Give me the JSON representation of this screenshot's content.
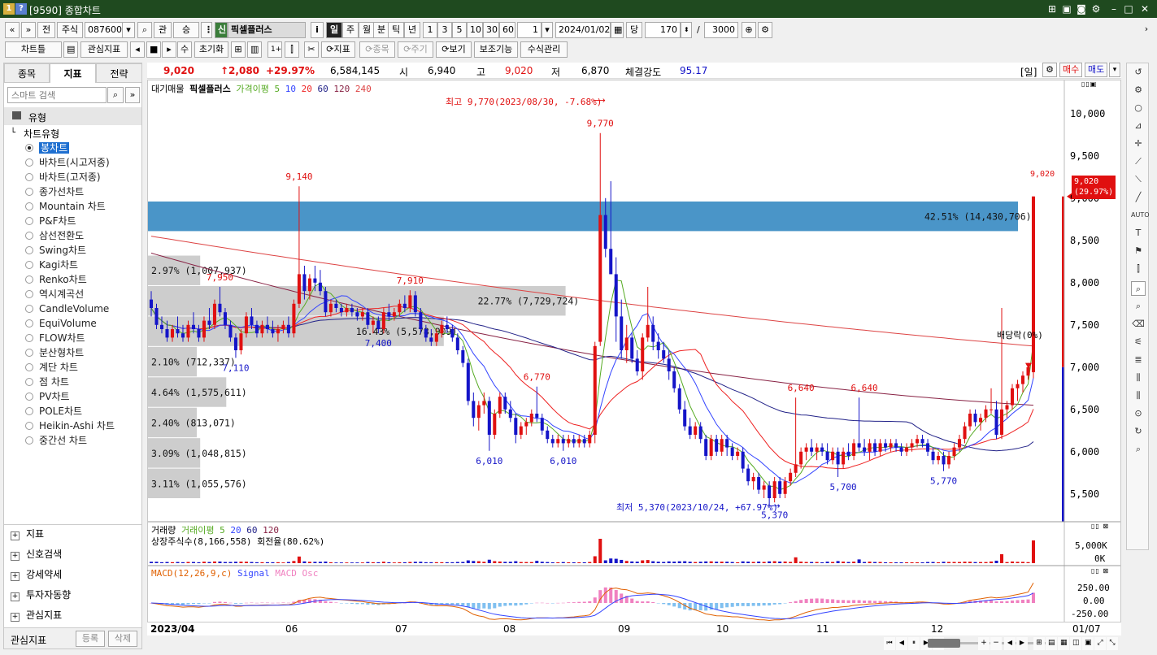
{
  "window": {
    "icon1": "1",
    "icon2": "?",
    "title": "[9590] 종합차트"
  },
  "toolbar1": {
    "nav_prev": "«",
    "nav_up": "»",
    "prev": "전",
    "market": "주식",
    "code": "087600",
    "gwan": "관",
    "seung": "승",
    "sin_badge": "신",
    "stock_name": "픽셀플러스",
    "info": "i",
    "periods": [
      "일",
      "주",
      "월",
      "분",
      "틱",
      "년"
    ],
    "intervals": [
      "1",
      "3",
      "5",
      "10",
      "30",
      "60"
    ],
    "interval_value": "1",
    "date": "2024/01/02",
    "dang": "당",
    "count": "170",
    "slash": "/",
    "max": "3000"
  },
  "toolbar2": {
    "chart_frame": "차트틀",
    "watch_indicator": "관심지표",
    "su": "수",
    "reset": "초기화",
    "scissors": "✂",
    "indicator": "지표",
    "item": "종목",
    "cycle": "주기",
    "view": "보기",
    "aux": "보조기능",
    "formula": "수식관리"
  },
  "left": {
    "tabs": [
      "종목",
      "지표",
      "전략"
    ],
    "search_placeholder": "스마트 검색",
    "group": "유형",
    "subgroup": "차트유형",
    "types": [
      "봉차트",
      "바차트(시고저종)",
      "바차트(고저종)",
      "종가선차트",
      "Mountain 차트",
      "P&F차트",
      "삼선전환도",
      "Swing차트",
      "Kagi차트",
      "Renko차트",
      "역시계곡선",
      "CandleVolume",
      "EquiVolume",
      "FLOW차트",
      "분산형차트",
      "계단 차트",
      "점 차트",
      "PV차트",
      "POLE차트",
      "Heikin-Ashi 차트",
      "중간선 차트"
    ],
    "sections": [
      "지표",
      "신호검색",
      "강세약세",
      "투자자동향",
      "관심지표"
    ],
    "footer_label": "관심지표",
    "register": "등록",
    "delete": "삭제"
  },
  "info": {
    "price": "9,020",
    "change": "↑2,080",
    "rate": "+29.97%",
    "volume": "6,584,145",
    "open_label": "시",
    "open": "6,940",
    "high_label": "고",
    "high": "9,020",
    "low_label": "저",
    "low": "6,870",
    "strength_label": "체결강도",
    "strength": "95.17",
    "period_tag": "[일]",
    "buy": "매수",
    "sell": "매도"
  },
  "legend": {
    "a": "대기매물",
    "b": "픽셀플러스",
    "c": "가격이평 5",
    "d": "10",
    "e": "20",
    "f": "60",
    "g": "120",
    "h": "240"
  },
  "annotations": {
    "high_note": "최고 9,770(2023/08/30, -7.68%)",
    "low_note": "최저 5,370(2023/10/24, +67.97%)",
    "dividend": "배당락(0%)",
    "last_price": "9,020",
    "last_tag1": "9,020",
    "last_tag2": "(29.97%)"
  },
  "colors": {
    "up": "#e01010",
    "down": "#1414c8",
    "ma5": "#55aa22",
    "ma10": "#3344ff",
    "ma20": "#ee2222",
    "ma60": "#222288",
    "ma120": "#882244",
    "ma240": "#dd4444",
    "profile_blue": "#4a95c8",
    "profile_gray": "#c8c8c8"
  },
  "chart_data": {
    "type": "candlestick",
    "period": "daily",
    "ylim": [
      5200,
      10200
    ],
    "y_ticks": [
      "10,000",
      "9,500",
      "9,000",
      "8,500",
      "8,000",
      "7,500",
      "7,000",
      "6,500",
      "6,000",
      "5,500"
    ],
    "x_ticks": [
      "2023/04",
      "06",
      "07",
      "08",
      "09",
      "10",
      "11",
      "12",
      "01/07"
    ],
    "price_labels": [
      {
        "text": "9,140",
        "i": 28,
        "v": 9140,
        "pos": "above"
      },
      {
        "text": "7,950",
        "i": 13,
        "v": 7950,
        "pos": "above"
      },
      {
        "text": "7,110",
        "i": 16,
        "v": 7110,
        "pos": "below"
      },
      {
        "text": "7,910",
        "i": 49,
        "v": 7910,
        "pos": "above"
      },
      {
        "text": "7,400",
        "i": 43,
        "v": 7400,
        "pos": "below"
      },
      {
        "text": "9,770",
        "i": 85,
        "v": 9770,
        "pos": "above"
      },
      {
        "text": "6,770",
        "i": 73,
        "v": 6770,
        "pos": "above"
      },
      {
        "text": "6,010",
        "i": 64,
        "v": 6010,
        "pos": "below"
      },
      {
        "text": "6,010",
        "i": 78,
        "v": 6010,
        "pos": "below"
      },
      {
        "text": "6,640",
        "i": 123,
        "v": 6640,
        "pos": "above"
      },
      {
        "text": "6,640",
        "i": 135,
        "v": 6640,
        "pos": "above"
      },
      {
        "text": "5,370",
        "i": 118,
        "v": 5370,
        "pos": "below"
      },
      {
        "text": "5,700",
        "i": 131,
        "v": 5700,
        "pos": "below"
      },
      {
        "text": "5,770",
        "i": 150,
        "v": 5770,
        "pos": "below"
      }
    ],
    "profile": [
      {
        "lo": 8600,
        "hi": 8960,
        "w": 1.0,
        "label": "42.51% (14,430,706)",
        "color": "blue"
      },
      {
        "lo": 7960,
        "hi": 8320,
        "w": 0.06,
        "label": "2.97% (1,007,937)",
        "color": "gray"
      },
      {
        "lo": 7600,
        "hi": 7960,
        "w": 0.48,
        "label": "22.77% (7,729,724)",
        "color": "gray"
      },
      {
        "lo": 7240,
        "hi": 7600,
        "w": 0.34,
        "label": "16.43% (5,578,909)",
        "color": "gray"
      },
      {
        "lo": 6880,
        "hi": 7240,
        "w": 0.04,
        "label": "2.10% (712,337)",
        "color": "gray"
      },
      {
        "lo": 6520,
        "hi": 6880,
        "w": 0.09,
        "label": "4.64% (1,575,611)",
        "color": "gray"
      },
      {
        "lo": 6160,
        "hi": 6520,
        "w": 0.05,
        "label": "2.40% (813,071)",
        "color": "gray"
      },
      {
        "lo": 5800,
        "hi": 6160,
        "w": 0.06,
        "label": "3.09% (1,048,815)",
        "color": "gray"
      },
      {
        "lo": 5440,
        "hi": 5800,
        "w": 0.06,
        "label": "3.11% (1,055,576)",
        "color": "gray"
      }
    ],
    "candles": [
      [
        7800,
        7900,
        7600,
        7700
      ],
      [
        7700,
        7750,
        7450,
        7500
      ],
      [
        7500,
        7600,
        7400,
        7450
      ],
      [
        7450,
        7550,
        7300,
        7350
      ],
      [
        7350,
        7500,
        7300,
        7450
      ],
      [
        7450,
        7600,
        7350,
        7400
      ],
      [
        7400,
        7500,
        7300,
        7350
      ],
      [
        7350,
        7550,
        7300,
        7500
      ],
      [
        7500,
        7650,
        7400,
        7450
      ],
      [
        7450,
        7500,
        7300,
        7350
      ],
      [
        7350,
        7600,
        7300,
        7550
      ],
      [
        7550,
        7700,
        7450,
        7500
      ],
      [
        7500,
        7800,
        7450,
        7750
      ],
      [
        7750,
        7950,
        7600,
        7650
      ],
      [
        7650,
        7700,
        7450,
        7500
      ],
      [
        7500,
        7550,
        7300,
        7350
      ],
      [
        7350,
        7400,
        7110,
        7200
      ],
      [
        7200,
        7450,
        7150,
        7400
      ],
      [
        7400,
        7650,
        7350,
        7600
      ],
      [
        7600,
        7700,
        7450,
        7500
      ],
      [
        7500,
        7550,
        7350,
        7400
      ],
      [
        7400,
        7550,
        7350,
        7500
      ],
      [
        7500,
        7600,
        7400,
        7450
      ],
      [
        7450,
        7550,
        7350,
        7400
      ],
      [
        7400,
        7500,
        7300,
        7450
      ],
      [
        7450,
        7550,
        7400,
        7500
      ],
      [
        7500,
        7600,
        7350,
        7400
      ],
      [
        7400,
        7800,
        7350,
        7750
      ],
      [
        7750,
        9140,
        7700,
        8100
      ],
      [
        8100,
        8200,
        7800,
        7900
      ],
      [
        7900,
        8100,
        7800,
        8050
      ],
      [
        8050,
        8200,
        7900,
        8000
      ],
      [
        8000,
        8150,
        7850,
        7900
      ],
      [
        7900,
        7950,
        7600,
        7650
      ],
      [
        7650,
        7800,
        7600,
        7750
      ],
      [
        7750,
        7800,
        7650,
        7700
      ],
      [
        7700,
        7750,
        7600,
        7650
      ],
      [
        7650,
        7750,
        7600,
        7700
      ],
      [
        7700,
        7750,
        7600,
        7650
      ],
      [
        7650,
        7700,
        7550,
        7600
      ],
      [
        7600,
        7700,
        7550,
        7650
      ],
      [
        7650,
        7700,
        7450,
        7500
      ],
      [
        7500,
        7600,
        7400,
        7550
      ],
      [
        7550,
        7600,
        7400,
        7450
      ],
      [
        7450,
        7700,
        7400,
        7650
      ],
      [
        7650,
        7750,
        7550,
        7600
      ],
      [
        7600,
        7700,
        7550,
        7650
      ],
      [
        7650,
        7800,
        7600,
        7750
      ],
      [
        7750,
        7850,
        7650,
        7700
      ],
      [
        7700,
        7910,
        7650,
        7850
      ],
      [
        7850,
        7900,
        7600,
        7650
      ],
      [
        7650,
        7700,
        7400,
        7450
      ],
      [
        7450,
        7500,
        7300,
        7350
      ],
      [
        7350,
        7450,
        7250,
        7300
      ],
      [
        7300,
        7450,
        7250,
        7400
      ],
      [
        7400,
        7550,
        7350,
        7500
      ],
      [
        7500,
        7600,
        7400,
        7450
      ],
      [
        7450,
        7500,
        7300,
        7350
      ],
      [
        7350,
        7400,
        7150,
        7200
      ],
      [
        7200,
        7250,
        7000,
        7050
      ],
      [
        7050,
        7100,
        6550,
        6600
      ],
      [
        6600,
        6700,
        6300,
        6400
      ],
      [
        6400,
        6600,
        6250,
        6550
      ],
      [
        6550,
        6700,
        6450,
        6600
      ],
      [
        6600,
        6650,
        6010,
        6200
      ],
      [
        6200,
        6500,
        6150,
        6450
      ],
      [
        6450,
        6700,
        6400,
        6650
      ],
      [
        6650,
        6700,
        6450,
        6500
      ],
      [
        6500,
        6600,
        6350,
        6400
      ],
      [
        6400,
        6450,
        6100,
        6200
      ],
      [
        6200,
        6350,
        6150,
        6300
      ],
      [
        6300,
        6400,
        6200,
        6350
      ],
      [
        6350,
        6500,
        6300,
        6450
      ],
      [
        6450,
        6770,
        6350,
        6400
      ],
      [
        6400,
        6450,
        6200,
        6250
      ],
      [
        6250,
        6300,
        6100,
        6150
      ],
      [
        6150,
        6200,
        6050,
        6100
      ],
      [
        6100,
        6200,
        6050,
        6150
      ],
      [
        6150,
        6200,
        6010,
        6100
      ],
      [
        6100,
        6200,
        6050,
        6150
      ],
      [
        6150,
        6200,
        6050,
        6100
      ],
      [
        6100,
        6200,
        6050,
        6150
      ],
      [
        6150,
        6200,
        6050,
        6100
      ],
      [
        6100,
        6250,
        6050,
        6200
      ],
      [
        6200,
        7300,
        6100,
        7250
      ],
      [
        7300,
        9770,
        7250,
        8800
      ],
      [
        8800,
        9000,
        8300,
        8400
      ],
      [
        8400,
        9200,
        8100,
        8100
      ],
      [
        8100,
        8300,
        7300,
        7600
      ],
      [
        7600,
        7800,
        7100,
        7200
      ],
      [
        7200,
        7500,
        7050,
        7350
      ],
      [
        7350,
        7400,
        7050,
        7100
      ],
      [
        7100,
        7200,
        6900,
        6950
      ],
      [
        6950,
        7400,
        6850,
        7350
      ],
      [
        7350,
        7950,
        7300,
        7500
      ],
      [
        7500,
        7600,
        7200,
        7300
      ],
      [
        7300,
        7400,
        7100,
        7200
      ],
      [
        7200,
        7300,
        7050,
        7100
      ],
      [
        7100,
        7200,
        6850,
        6950
      ],
      [
        6950,
        7000,
        6700,
        6750
      ],
      [
        6750,
        6800,
        6450,
        6500
      ],
      [
        6500,
        6600,
        6250,
        6300
      ],
      [
        6300,
        6400,
        6150,
        6200
      ],
      [
        6200,
        6350,
        6150,
        6300
      ],
      [
        6300,
        6350,
        6100,
        6150
      ],
      [
        6150,
        6200,
        5900,
        5950
      ],
      [
        5950,
        6200,
        5900,
        6150
      ],
      [
        6150,
        6200,
        5950,
        6000
      ],
      [
        6000,
        6200,
        5950,
        6150
      ],
      [
        6150,
        6200,
        5950,
        6050
      ],
      [
        6050,
        6100,
        5900,
        5950
      ],
      [
        5950,
        6050,
        5900,
        6000
      ],
      [
        6000,
        6050,
        5750,
        5800
      ],
      [
        5800,
        5850,
        5600,
        5650
      ],
      [
        5650,
        5750,
        5550,
        5700
      ],
      [
        5700,
        5750,
        5500,
        5550
      ],
      [
        5550,
        5650,
        5450,
        5600
      ],
      [
        5600,
        5650,
        5370,
        5450
      ],
      [
        5450,
        5700,
        5400,
        5650
      ],
      [
        5650,
        5700,
        5450,
        5500
      ],
      [
        5500,
        5700,
        5450,
        5650
      ],
      [
        5650,
        5800,
        5600,
        5750
      ],
      [
        5750,
        6640,
        5700,
        5850
      ],
      [
        5850,
        6050,
        5800,
        6000
      ],
      [
        6000,
        6100,
        5900,
        6050
      ],
      [
        6050,
        6150,
        5950,
        6000
      ],
      [
        6000,
        6100,
        5900,
        6050
      ],
      [
        6050,
        6100,
        5950,
        6000
      ],
      [
        6000,
        6100,
        5850,
        5900
      ],
      [
        5900,
        6050,
        5850,
        6000
      ],
      [
        6000,
        6050,
        5700,
        5850
      ],
      [
        5850,
        6050,
        5800,
        6000
      ],
      [
        6000,
        6100,
        5900,
        5950
      ],
      [
        5950,
        6150,
        5900,
        6100
      ],
      [
        6100,
        6640,
        6000,
        6050
      ],
      [
        6050,
        6150,
        5950,
        6000
      ],
      [
        6000,
        6150,
        5900,
        6100
      ],
      [
        6100,
        6150,
        5950,
        6000
      ],
      [
        6000,
        6150,
        5950,
        6100
      ],
      [
        6100,
        6150,
        6000,
        6050
      ],
      [
        6050,
        6150,
        6000,
        6100
      ],
      [
        6100,
        6150,
        6000,
        6050
      ],
      [
        6050,
        6100,
        5950,
        6000
      ],
      [
        6000,
        6100,
        5950,
        6050
      ],
      [
        6050,
        6150,
        6000,
        6100
      ],
      [
        6100,
        6200,
        6050,
        6150
      ],
      [
        6150,
        6200,
        6050,
        6100
      ],
      [
        6100,
        6150,
        5950,
        6000
      ],
      [
        6000,
        6050,
        5850,
        5900
      ],
      [
        5900,
        6000,
        5850,
        5950
      ],
      [
        5950,
        6000,
        5770,
        5850
      ],
      [
        5850,
        6000,
        5800,
        5950
      ],
      [
        5950,
        6100,
        5900,
        6050
      ],
      [
        6050,
        6200,
        6000,
        6150
      ],
      [
        6150,
        6350,
        6100,
        6300
      ],
      [
        6300,
        6500,
        6250,
        6450
      ],
      [
        6450,
        6500,
        6300,
        6350
      ],
      [
        6350,
        6450,
        6250,
        6400
      ],
      [
        6400,
        6550,
        6350,
        6500
      ],
      [
        6500,
        6750,
        6450,
        6500
      ],
      [
        6500,
        6600,
        6150,
        6200
      ],
      [
        6200,
        7700,
        6150,
        6500
      ],
      [
        6500,
        6600,
        6400,
        6550
      ],
      [
        6550,
        6800,
        6500,
        6750
      ],
      [
        6750,
        6850,
        6600,
        6800
      ],
      [
        6800,
        6950,
        6700,
        6900
      ],
      [
        6900,
        7050,
        6850,
        7000
      ],
      [
        6940,
        9020,
        6870,
        9020
      ]
    ],
    "volume_pane": {
      "title": "거래량",
      "ma5": "거래이평 5",
      "ma20": "20",
      "ma60": "60",
      "ma120": "120",
      "info": "상장주식수(8,166,558) 회전율(80.62%)",
      "ticks": [
        "5,000K",
        "0K"
      ]
    },
    "macd_pane": {
      "title": "MACD(12,26,9,c)",
      "signal": "Signal",
      "osc": "MACD Osc",
      "ticks": [
        "250.00",
        "0.00",
        "-250.00"
      ]
    }
  },
  "bottom": {
    "buttons": [
      "⏮",
      "◀",
      "⏸",
      "▶",
      "⏭",
      "+",
      "−",
      "◀",
      "▶"
    ]
  }
}
